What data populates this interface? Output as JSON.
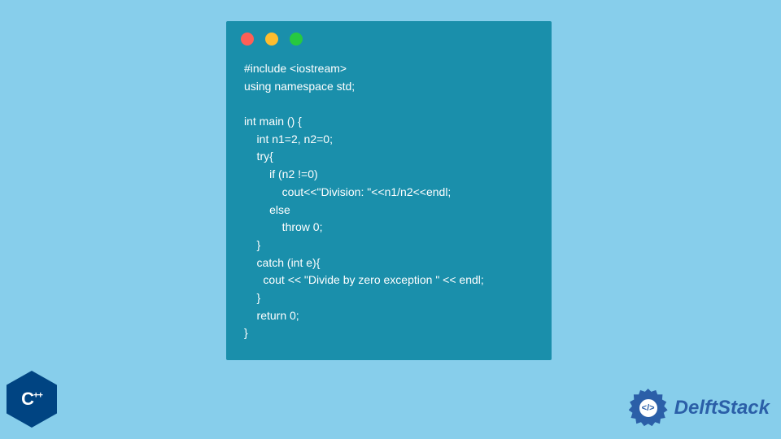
{
  "window": {
    "dots": [
      "red",
      "yellow",
      "green"
    ]
  },
  "code": {
    "lines": [
      "#include <iostream>",
      "using namespace std;",
      "",
      "int main () {",
      "    int n1=2, n2=0;",
      "    try{",
      "        if (n2 !=0)",
      "            cout<<\"Division: \"<<n1/n2<<endl;",
      "        else",
      "            throw 0;",
      "    }",
      "    catch (int e){",
      "      cout << \"Divide by zero exception \" << endl;",
      "    }",
      "    return 0;",
      "}"
    ]
  },
  "cpp_logo": {
    "letter": "C",
    "plus": "++"
  },
  "brand": {
    "name": "DelftStack",
    "icon_label": "</>"
  },
  "colors": {
    "page_bg": "#87ceeb",
    "window_bg": "#1a8fab",
    "code_fg": "#ffffff",
    "dot_red": "#ff5f56",
    "dot_yellow": "#ffbd2e",
    "dot_green": "#27c93f",
    "cpp_badge": "#004482",
    "brand_blue": "#2b5fa8"
  }
}
